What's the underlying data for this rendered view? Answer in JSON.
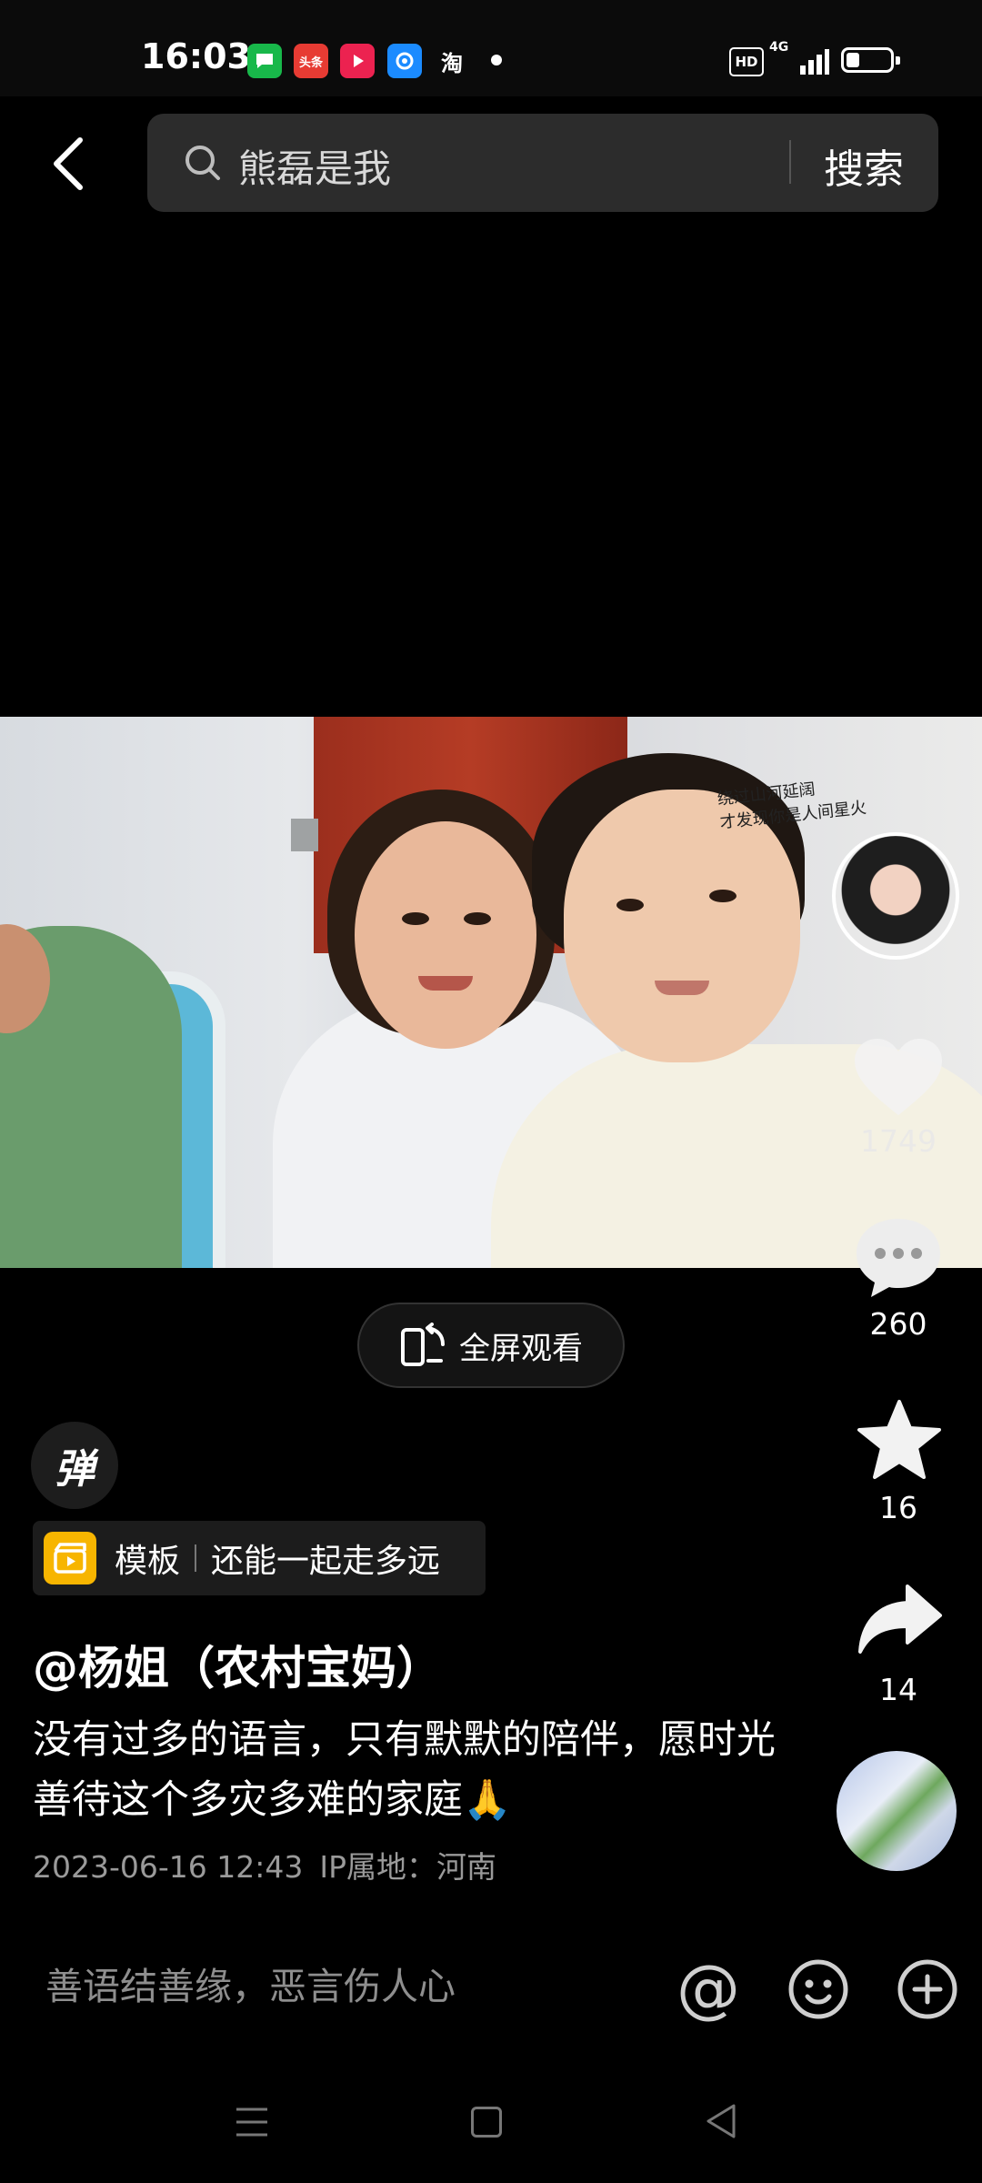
{
  "status_bar": {
    "time": "16:03",
    "icons": [
      "message-app-icon",
      "toutiao-icon",
      "video-app-icon",
      "browser-icon",
      "taobao-icon",
      "notification-dot-icon"
    ],
    "toutiao_label": "头条",
    "taobao_label": "淘",
    "hd_label": "HD",
    "network_label": "4G",
    "battery_level": 0.3
  },
  "search": {
    "query": "熊磊是我",
    "button_label": "搜索"
  },
  "video": {
    "overlay_text_line1": "绕过山河延阔",
    "overlay_text_line2": "才发现你是人间星火"
  },
  "actions": {
    "like_count": "1749",
    "comment_count": "260",
    "favorite_count": "16",
    "share_count": "14"
  },
  "fullscreen_label": "全屏观看",
  "danmaku_label": "弹",
  "template": {
    "word": "模板",
    "name": "还能一起走多远"
  },
  "post": {
    "author": "@杨姐（农村宝妈）",
    "caption": "没有过多的语言，只有默默的陪伴，愿时光善待这个多灾多难的家庭🙏",
    "date": "2023-06-16 12:43",
    "location": "IP属地：河南"
  },
  "comment_bar": {
    "placeholder": "善语结善缘，恶言伤人心",
    "at_symbol": "@"
  },
  "colors": {
    "background": "#000000",
    "search_bg": "#2c2c2c",
    "template_icon": "#f7b500",
    "muted_text": "#9a9a9a"
  }
}
